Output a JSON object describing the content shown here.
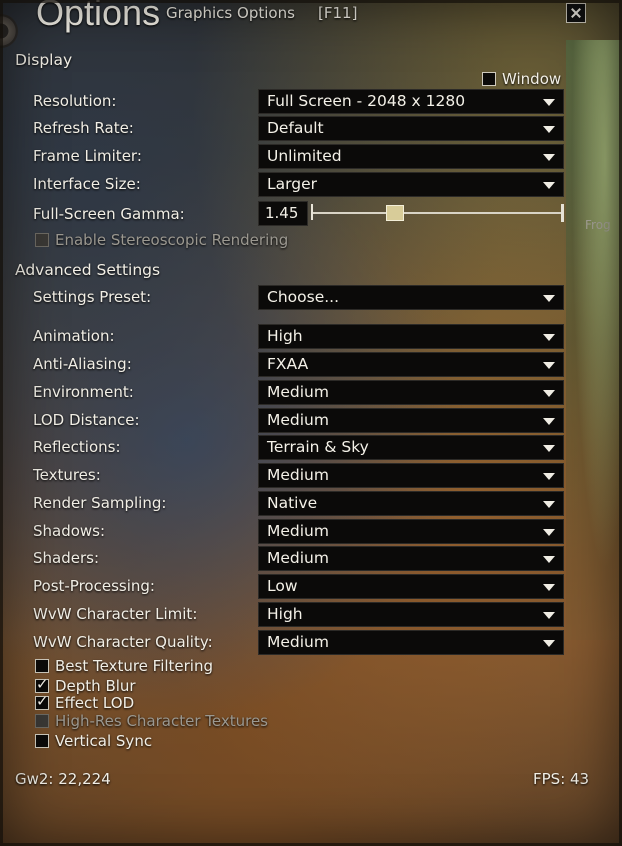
{
  "window": {
    "title": "Options",
    "subtitle": "Graphics Options",
    "hotkey": "[F11]",
    "close_label": "close"
  },
  "display": {
    "heading": "Display",
    "window_checkbox": {
      "label": "Window",
      "checked": false
    },
    "resolution": {
      "label": "Resolution:",
      "value": "Full Screen - 2048 x 1280"
    },
    "refresh_rate": {
      "label": "Refresh Rate:",
      "value": "Default"
    },
    "frame_limiter": {
      "label": "Frame Limiter:",
      "value": "Unlimited"
    },
    "interface_size": {
      "label": "Interface Size:",
      "value": "Larger"
    },
    "gamma": {
      "label": "Full-Screen Gamma:",
      "value": "1.45",
      "slider_fraction": 0.33
    },
    "stereoscopic": {
      "label": "Enable Stereoscopic Rendering",
      "checked": false,
      "disabled": true
    },
    "side_text": "Frog"
  },
  "advanced": {
    "heading": "Advanced Settings",
    "preset": {
      "label": "Settings Preset:",
      "value": "Choose..."
    },
    "settings": [
      {
        "label": "Animation:",
        "value": "High"
      },
      {
        "label": "Anti-Aliasing:",
        "value": "FXAA"
      },
      {
        "label": "Environment:",
        "value": "Medium"
      },
      {
        "label": "LOD Distance:",
        "value": "Medium"
      },
      {
        "label": "Reflections:",
        "value": "Terrain & Sky"
      },
      {
        "label": "Textures:",
        "value": "Medium"
      },
      {
        "label": "Render Sampling:",
        "value": "Native"
      },
      {
        "label": "Shadows:",
        "value": "Medium"
      },
      {
        "label": "Shaders:",
        "value": "Medium"
      },
      {
        "label": "Post-Processing:",
        "value": "Low"
      },
      {
        "label": "WvW Character Limit:",
        "value": "High"
      },
      {
        "label": "WvW Character Quality:",
        "value": "Medium"
      }
    ],
    "checkboxes": [
      {
        "label": "Best Texture Filtering",
        "checked": false,
        "disabled": false
      },
      {
        "label": "Depth Blur",
        "checked": true,
        "disabled": false
      },
      {
        "label": "Effect LOD",
        "checked": true,
        "disabled": false
      },
      {
        "label": "High-Res Character Textures",
        "checked": false,
        "disabled": true
      },
      {
        "label": "Vertical Sync",
        "checked": false,
        "disabled": false
      }
    ]
  },
  "footer": {
    "build": "Gw2: 22,224",
    "fps": "FPS: 43"
  }
}
